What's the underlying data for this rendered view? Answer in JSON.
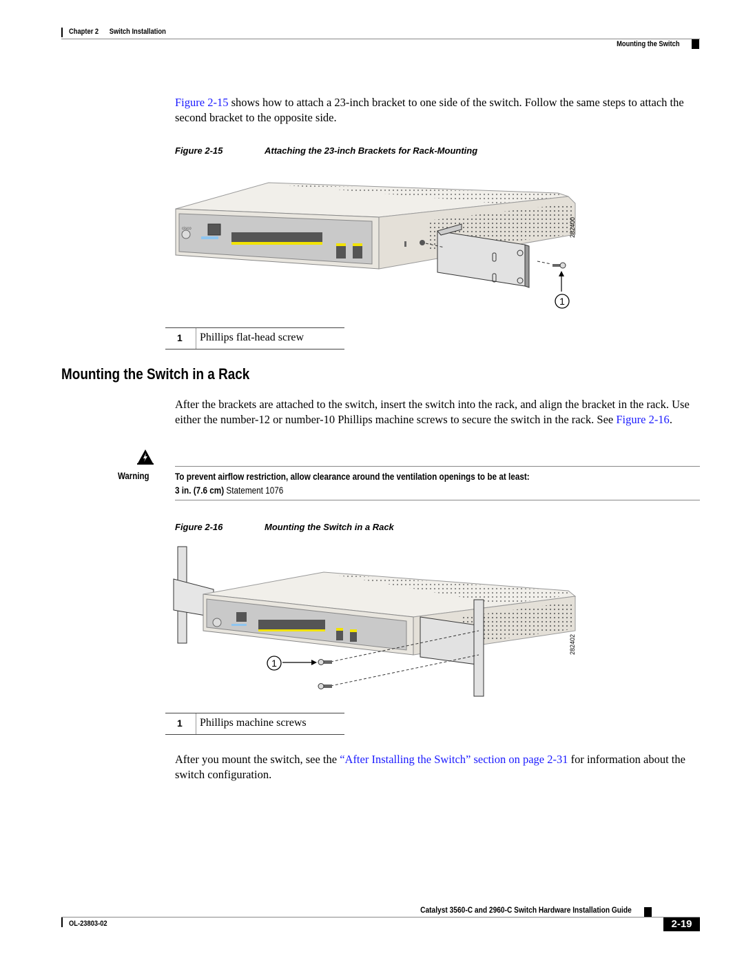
{
  "header": {
    "chapter": "Chapter 2      Switch Installation",
    "section": "Mounting the Switch"
  },
  "intro": {
    "link": "Figure 2-15",
    "text": " shows how to attach a 23-inch bracket to one side of the switch. Follow the same steps to attach the second bracket to the opposite side."
  },
  "figure1": {
    "number": "Figure 2-15",
    "title": "Attaching the 23-inch Brackets for Rack-Mounting",
    "art_id": "282400",
    "callout": "1",
    "legend": [
      {
        "num": "1",
        "text": "Phillips flat-head screw"
      }
    ]
  },
  "section": {
    "heading": "Mounting the Switch in a Rack",
    "paragraph": "After the brackets are attached to the switch, insert the switch into the rack, and align the bracket in the rack. Use either the number-12 or number-10 Phillips machine screws to secure the switch in the rack. See ",
    "paragraph_link": "Figure 2-16",
    "paragraph_end": "."
  },
  "warning": {
    "label": "Warning",
    "icon": "warning-triangle-icon",
    "line1": "To prevent airflow restriction, allow clearance around the ventilation openings to be at least:",
    "line2_bold": "3 in. (7.6 cm)",
    "line2_normal": " Statement 1076"
  },
  "figure2": {
    "number": "Figure 2-16",
    "title": "Mounting the Switch in a Rack",
    "art_id": "282402",
    "callout": "1",
    "legend": [
      {
        "num": "1",
        "text": "Phillips machine screws"
      }
    ]
  },
  "closing": {
    "pre": "After you mount the switch, see the ",
    "link": "“After Installing the Switch” section on page 2-31",
    "post": " for information about the switch configuration."
  },
  "footer": {
    "title": "Catalyst 3560-C and 2960-C Switch Hardware Installation Guide",
    "doc_number": "OL-23803-02",
    "page": "2-19"
  },
  "colors": {
    "link": "#1a1aff",
    "cable_yellow": "#f2e300",
    "switch_body": "#e8e4dc"
  }
}
